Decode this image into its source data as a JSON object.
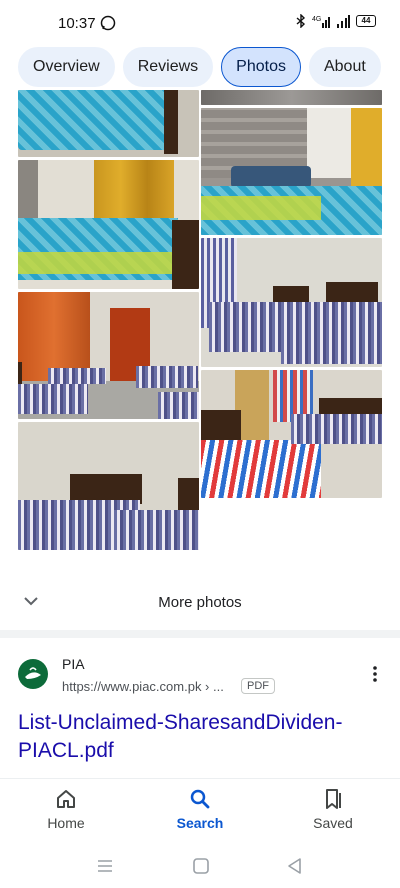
{
  "status_bar": {
    "time": "10:37",
    "network": "4G",
    "battery": "44"
  },
  "tabs": [
    {
      "label": "Overview",
      "active": false
    },
    {
      "label": "Reviews",
      "active": false
    },
    {
      "label": "Photos",
      "active": true
    },
    {
      "label": "About",
      "active": false
    }
  ],
  "more_photos_label": "More photos",
  "result": {
    "site_name": "PIA",
    "url": "https://www.piac.com.pk › ...",
    "file_type": "PDF",
    "title": "List-Unclaimed-SharesandDividen-PIACL.pdf"
  },
  "bottom_nav": [
    {
      "label": "Home",
      "icon": "home-icon"
    },
    {
      "label": "Search",
      "icon": "search-icon",
      "active": true
    },
    {
      "label": "Saved",
      "icon": "bookmark-icon"
    }
  ],
  "system_nav": {
    "icons": [
      "menu-icon",
      "home-square-icon",
      "back-triangle-icon"
    ]
  },
  "colors": {
    "accent": "#0b57d0",
    "link": "#1a0dab",
    "tab_bg": "#eaf1fb",
    "tab_active_bg": "#d3e3fd"
  }
}
